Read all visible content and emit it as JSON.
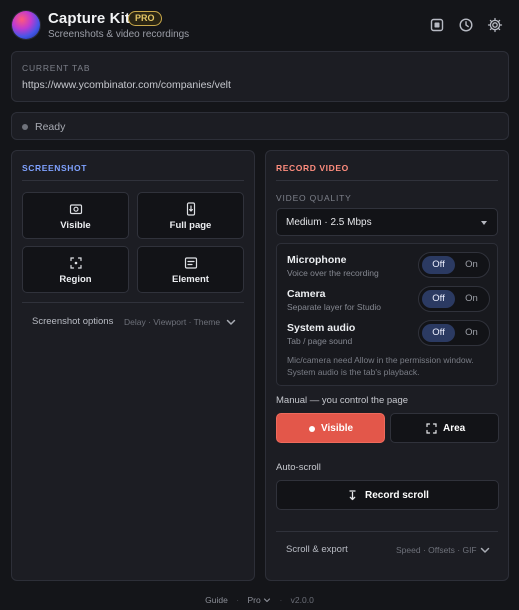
{
  "header": {
    "title": "Capture Kit",
    "badge": "PRO",
    "subtitle": "Screenshots & video recordings",
    "icons": [
      "stop-square-icon",
      "history-clock-icon",
      "gear-icon"
    ]
  },
  "current_tab": {
    "label": "CURRENT TAB",
    "url": "https://www.ycombinator.com/companies/velt"
  },
  "status": {
    "text": "Ready",
    "dot_color": "#6f727b"
  },
  "screenshot": {
    "heading": "SCREENSHOT",
    "tiles": [
      {
        "label": "Visible",
        "icon": "camera-icon"
      },
      {
        "label": "Full page",
        "icon": "phone-scroll-icon"
      },
      {
        "label": "Region",
        "icon": "region-select-icon"
      },
      {
        "label": "Element",
        "icon": "element-box-icon"
      }
    ],
    "options": {
      "title": "Screenshot options",
      "hint": "Delay · Viewport · Theme"
    }
  },
  "record": {
    "heading": "RECORD VIDEO",
    "quality_label": "VIDEO QUALITY",
    "quality_value": "Medium · 2.5 Mbps",
    "sources": [
      {
        "title": "Microphone",
        "subtitle": "Voice over the recording",
        "off": "Off",
        "on": "On",
        "selected": "off"
      },
      {
        "title": "Camera",
        "subtitle": "Separate layer for Studio",
        "off": "Off",
        "on": "On",
        "selected": "off"
      },
      {
        "title": "System audio",
        "subtitle": "Tab / page sound",
        "off": "Off",
        "on": "On",
        "selected": "off"
      }
    ],
    "note": "Mic/camera need Allow in the permission window. System audio is the tab's playback.",
    "manual_label": "Manual — you control the page",
    "visible_button": "Visible",
    "area_button": "Area",
    "auto_label": "Auto-scroll",
    "record_scroll_button": "Record scroll",
    "scroll_export": {
      "title": "Scroll & export",
      "hint": "Speed · Offsets · GIF"
    }
  },
  "footer": {
    "guide": "Guide",
    "pro": "Pro",
    "version": "v2.0.0"
  },
  "colors": {
    "accent_blue": "#7fa2ff",
    "accent_red": "#e3574a",
    "badge_gold": "#e3c565"
  }
}
